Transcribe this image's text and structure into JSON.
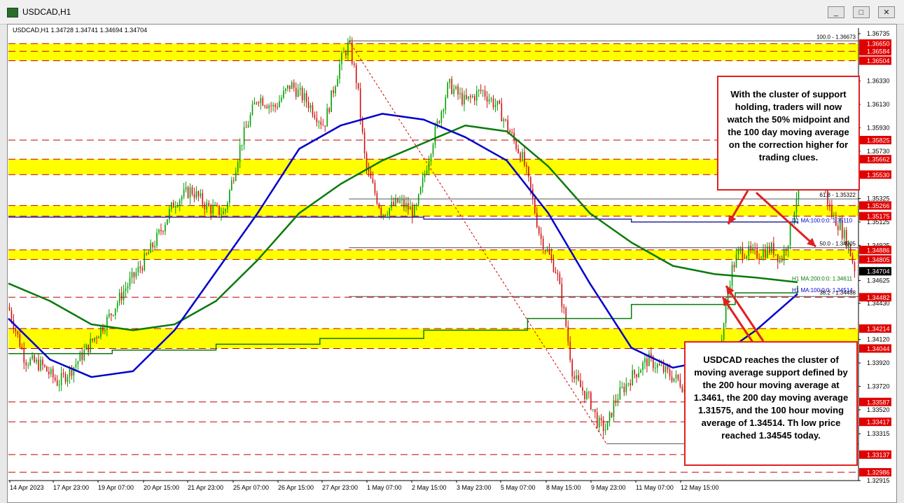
{
  "window": {
    "title": "USDCAD,H1",
    "buttons": [
      {
        "name": "minimize-button",
        "glyph": "_"
      },
      {
        "name": "maximize-button",
        "glyph": "□"
      },
      {
        "name": "close-button",
        "glyph": "✕"
      }
    ]
  },
  "header": {
    "symbol_line": "USDCAD,H1  1.34728 1.34741 1.34694 1.34704"
  },
  "colors": {
    "zone": "#ffff00",
    "price_up": "#00a000",
    "price_down": "#d01010",
    "ma_blue": "#0000cc",
    "ma_green": "#0a7a0a",
    "note_border": "#e02020"
  },
  "chart_data": {
    "type": "line",
    "series_style": "candlestick",
    "ylim": [
      1.32915,
      1.36735
    ],
    "y_ticks": [
      "1.36735",
      "1.36330",
      "1.36130",
      "1.35930",
      "1.35730",
      "1.35325",
      "1.35125",
      "1.34925",
      "1.34625",
      "1.34430",
      "1.34120",
      "1.33920",
      "1.33720",
      "1.33520",
      "1.33315",
      "1.32915"
    ],
    "x_ticks": [
      "14 Apr 2023",
      "17 Apr 23:00",
      "19 Apr 07:00",
      "20 Apr 15:00",
      "21 Apr 23:00",
      "25 Apr 07:00",
      "26 Apr 15:00",
      "27 Apr 23:00",
      "1 May 07:00",
      "2 May 15:00",
      "3 May 23:00",
      "5 May 07:00",
      "8 May 15:00",
      "9 May 23:00",
      "11 May 07:00",
      "12 May 15:00"
    ],
    "zones": [
      {
        "from": 1.36504,
        "to": 1.3665
      },
      {
        "from": 1.3553,
        "to": 1.35662
      },
      {
        "from": 1.35175,
        "to": 1.35266
      },
      {
        "from": 1.34805,
        "to": 1.34886
      },
      {
        "from": 1.34044,
        "to": 1.34214
      }
    ],
    "level_labels": [
      {
        "price": 1.3665,
        "label": "1.36650"
      },
      {
        "price": 1.36584,
        "label": "1.36584"
      },
      {
        "price": 1.36504,
        "label": "1.36504"
      },
      {
        "price": 1.35825,
        "label": "1.35825"
      },
      {
        "price": 1.35662,
        "label": "1.35662"
      },
      {
        "price": 1.3553,
        "label": "1.35530"
      },
      {
        "price": 1.35266,
        "label": "1.35266"
      },
      {
        "price": 1.35175,
        "label": "1.35175"
      },
      {
        "price": 1.34886,
        "label": "1.34886"
      },
      {
        "price": 1.34805,
        "label": "1.34805"
      },
      {
        "price": 1.34482,
        "label": "1.34482"
      },
      {
        "price": 1.34214,
        "label": "1.34214"
      },
      {
        "price": 1.34044,
        "label": "1.34044"
      },
      {
        "price": 1.33587,
        "label": "1.33587"
      },
      {
        "price": 1.33417,
        "label": "1.33417"
      },
      {
        "price": 1.33137,
        "label": "1.33137"
      },
      {
        "price": 1.32986,
        "label": "1.32986"
      }
    ],
    "current_price": {
      "price": 1.34704,
      "label": "1.34704"
    },
    "fib_levels": [
      {
        "price": 1.36673,
        "label": "100.0 - 1.36673"
      },
      {
        "price": 1.35322,
        "label": "61.8 - 1.35322"
      },
      {
        "price": 1.34905,
        "label": "50.0 - 1.34905"
      },
      {
        "price": 1.34488,
        "label": "38.2 - 1.34488"
      }
    ],
    "fib_edge_label": "37",
    "ma_labels": [
      {
        "price": 1.3511,
        "label": "D1 MA:100:0:0: 1.35110",
        "color": "#0000cc"
      },
      {
        "price": 1.34611,
        "label": "H1 MA:200:0:0: 1.34611",
        "color": "#0a7a0a"
      },
      {
        "price": 1.34514,
        "label": "H1 MA:100:0:0: 1.34514",
        "color": "#0000cc"
      }
    ],
    "price_path": [
      [
        0,
        1.344
      ],
      [
        16,
        1.3395
      ],
      [
        32,
        1.339
      ],
      [
        48,
        1.3375
      ],
      [
        64,
        1.339
      ],
      [
        80,
        1.341
      ],
      [
        96,
        1.343
      ],
      [
        112,
        1.3455
      ],
      [
        128,
        1.3475
      ],
      [
        144,
        1.35
      ],
      [
        160,
        1.353
      ],
      [
        176,
        1.354
      ],
      [
        192,
        1.3525
      ],
      [
        208,
        1.352
      ],
      [
        224,
        1.358
      ],
      [
        240,
        1.362
      ],
      [
        256,
        1.361
      ],
      [
        272,
        1.363
      ],
      [
        288,
        1.3615
      ],
      [
        304,
        1.3595
      ],
      [
        320,
        1.365
      ],
      [
        328,
        1.3665
      ],
      [
        336,
        1.363
      ],
      [
        344,
        1.356
      ],
      [
        352,
        1.354
      ],
      [
        360,
        1.352
      ],
      [
        376,
        1.353
      ],
      [
        392,
        1.352
      ],
      [
        408,
        1.358
      ],
      [
        424,
        1.363
      ],
      [
        440,
        1.3615
      ],
      [
        456,
        1.3625
      ],
      [
        472,
        1.361
      ],
      [
        480,
        1.3595
      ],
      [
        496,
        1.3565
      ],
      [
        504,
        1.3535
      ],
      [
        512,
        1.35
      ],
      [
        528,
        1.347
      ],
      [
        536,
        1.343
      ],
      [
        544,
        1.338
      ],
      [
        552,
        1.337
      ],
      [
        560,
        1.336
      ],
      [
        568,
        1.334
      ],
      [
        576,
        1.3335
      ],
      [
        584,
        1.336
      ],
      [
        600,
        1.338
      ],
      [
        616,
        1.3395
      ],
      [
        632,
        1.3385
      ],
      [
        648,
        1.3375
      ],
      [
        656,
        1.336
      ],
      [
        664,
        1.338
      ],
      [
        680,
        1.3385
      ],
      [
        688,
        1.342
      ],
      [
        696,
        1.347
      ],
      [
        704,
        1.3488
      ],
      [
        720,
        1.3485
      ],
      [
        736,
        1.349
      ],
      [
        744,
        1.348
      ],
      [
        752,
        1.35
      ],
      [
        760,
        1.354
      ],
      [
        768,
        1.356
      ],
      [
        776,
        1.3555
      ],
      [
        784,
        1.3548
      ],
      [
        792,
        1.352
      ],
      [
        800,
        1.351
      ],
      [
        808,
        1.3495
      ],
      [
        816,
        1.347
      ]
    ],
    "ma_blue_h1": [
      [
        0,
        1.343
      ],
      [
        40,
        1.3395
      ],
      [
        80,
        1.338
      ],
      [
        120,
        1.3385
      ],
      [
        160,
        1.342
      ],
      [
        200,
        1.347
      ],
      [
        240,
        1.352
      ],
      [
        280,
        1.3575
      ],
      [
        320,
        1.3595
      ],
      [
        360,
        1.3605
      ],
      [
        400,
        1.36
      ],
      [
        440,
        1.3585
      ],
      [
        480,
        1.3565
      ],
      [
        520,
        1.352
      ],
      [
        560,
        1.346
      ],
      [
        600,
        1.3405
      ],
      [
        640,
        1.3388
      ],
      [
        680,
        1.3395
      ],
      [
        720,
        1.342
      ],
      [
        760,
        1.3451
      ]
    ],
    "ma_green_h1": [
      [
        0,
        1.346
      ],
      [
        40,
        1.3445
      ],
      [
        80,
        1.3425
      ],
      [
        120,
        1.342
      ],
      [
        160,
        1.3425
      ],
      [
        200,
        1.3445
      ],
      [
        240,
        1.348
      ],
      [
        280,
        1.352
      ],
      [
        320,
        1.3545
      ],
      [
        360,
        1.3565
      ],
      [
        400,
        1.358
      ],
      [
        440,
        1.3595
      ],
      [
        480,
        1.359
      ],
      [
        520,
        1.356
      ],
      [
        560,
        1.352
      ],
      [
        600,
        1.3495
      ],
      [
        640,
        1.3475
      ],
      [
        680,
        1.3468
      ],
      [
        720,
        1.3465
      ],
      [
        760,
        1.3461
      ]
    ],
    "ma_blue_d1": [
      [
        0,
        1.35166
      ],
      [
        200,
        1.35166
      ],
      [
        400,
        1.3515
      ],
      [
        600,
        1.35125
      ],
      [
        760,
        1.3511
      ]
    ],
    "ma_green_d1": [
      [
        0,
        1.34
      ],
      [
        100,
        1.3403
      ],
      [
        200,
        1.3408
      ],
      [
        300,
        1.3413
      ],
      [
        400,
        1.342
      ],
      [
        500,
        1.343
      ],
      [
        600,
        1.3442
      ],
      [
        700,
        1.3452
      ],
      [
        760,
        1.3458
      ]
    ]
  },
  "annotations": [
    {
      "id": "upper-note",
      "text": "With the cluster of support holding, traders will now watch the 50% midpoint and the 100 day moving average on the correction higher for trading clues."
    },
    {
      "id": "lower-note",
      "text": "USDCAD reaches the cluster of moving average support defined by the 200 hour moving average at 1.3461, the 200 day moving average 1.31575, and the 100 hour moving average of 1.34514.  Th low price reached 1.34545 today."
    }
  ]
}
